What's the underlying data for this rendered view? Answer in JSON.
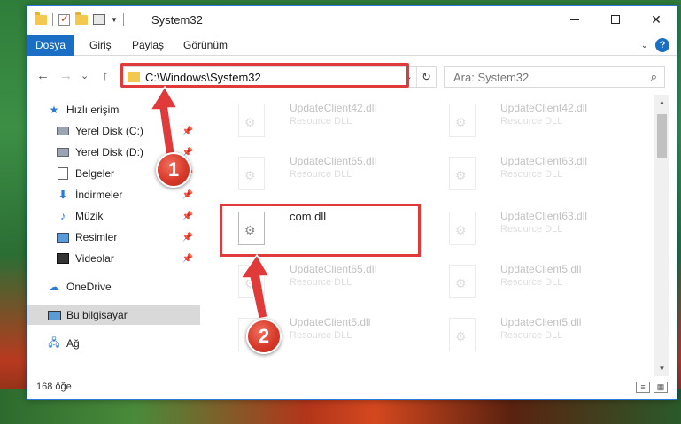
{
  "window": {
    "title": "System32",
    "minimize_icon": "minimize-icon",
    "maximize_icon": "maximize-icon",
    "close_label": "✕"
  },
  "ribbon": {
    "tabs": [
      "Dosya",
      "Giriş",
      "Paylaş",
      "Görünüm"
    ],
    "help_label": "?"
  },
  "nav": {
    "back": "←",
    "forward": "→",
    "recent": "⌄",
    "up": "↑",
    "address": "C:\\Windows\\System32",
    "dropdown": "⌄",
    "refresh": "↻"
  },
  "search": {
    "placeholder": "Ara: System32",
    "icon": "⌕"
  },
  "sidebar": {
    "items": [
      {
        "label": "Hızlı erişim",
        "icon": "star-icon"
      },
      {
        "label": "Yerel Disk (C:)",
        "icon": "disk-icon",
        "pinned": true
      },
      {
        "label": "Yerel Disk (D:)",
        "icon": "disk-icon",
        "pinned": true
      },
      {
        "label": "Belgeler",
        "icon": "document-icon",
        "pinned": true
      },
      {
        "label": "İndirmeler",
        "icon": "download-icon",
        "pinned": true
      },
      {
        "label": "Müzik",
        "icon": "music-icon",
        "pinned": true
      },
      {
        "label": "Resimler",
        "icon": "picture-icon",
        "pinned": true
      },
      {
        "label": "Videolar",
        "icon": "video-icon",
        "pinned": true
      },
      {
        "label": "OneDrive",
        "icon": "cloud-icon"
      },
      {
        "label": "Bu bilgisayar",
        "icon": "computer-icon",
        "selected": true
      },
      {
        "label": "Ağ",
        "icon": "network-icon"
      }
    ]
  },
  "files": [
    {
      "name": "UpdateClient42.dll",
      "type": "Resource DLL"
    },
    {
      "name": "UpdateClient42.dll",
      "type": "Resource DLL"
    },
    {
      "name": "UpdateClient65.dll",
      "type": "Resource DLL"
    },
    {
      "name": "UpdateClient63.dll",
      "type": "Resource DLL"
    },
    {
      "name": "com.dll",
      "type": ""
    },
    {
      "name": "UpdateClient63.dll",
      "type": "Resource DLL"
    },
    {
      "name": "UpdateClient65.dll",
      "type": "Resource DLL"
    },
    {
      "name": "UpdateClient5.dll",
      "type": "Resource DLL"
    },
    {
      "name": "UpdateClient5.dll",
      "type": "Resource DLL"
    },
    {
      "name": "UpdateClient5.dll",
      "type": "Resource DLL"
    }
  ],
  "status": {
    "count": "168 öğe"
  },
  "annotations": {
    "step1": "1",
    "step2": "2",
    "highlight_color": "#e03a3a"
  }
}
